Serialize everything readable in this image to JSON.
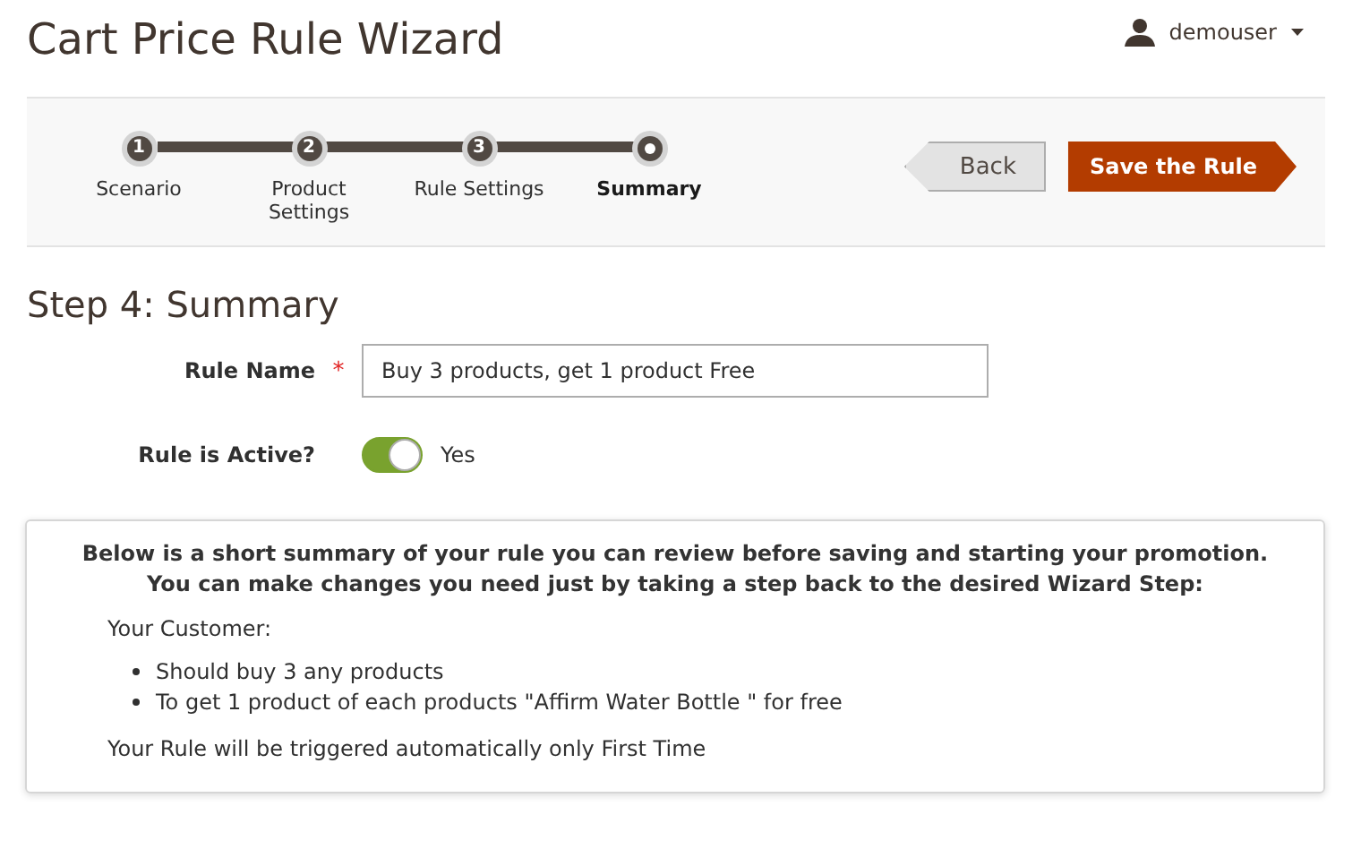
{
  "page_title": "Cart Price Rule Wizard",
  "user_menu": {
    "name": "demouser"
  },
  "steps": [
    {
      "number": "1",
      "label": "Scenario",
      "selected": false
    },
    {
      "number": "2",
      "label": "Product Settings",
      "selected": false
    },
    {
      "number": "3",
      "label": "Rule Settings",
      "selected": false
    },
    {
      "label": "Summary",
      "selected": true
    }
  ],
  "buttons": {
    "back": "Back",
    "save": "Save the Rule"
  },
  "section_title": "Step 4: Summary",
  "form": {
    "rule_name": {
      "label": "Rule Name",
      "required_mark": "*",
      "value": "Buy 3 products, get 1 product Free"
    },
    "rule_active": {
      "label": "Rule is Active?",
      "on": true,
      "state_text": "Yes"
    }
  },
  "summary": {
    "intro": [
      "Below is a short summary of your rule you can review before saving and starting your promotion.",
      "You can make changes you need just by taking a step back to the desired Wizard Step:"
    ],
    "customer_heading": "Your Customer:",
    "items": [
      "Should buy 3 any products",
      "To get 1 product of each products \"Affirm Water Bottle \" for free"
    ],
    "footer": "Your Rule will be triggered automatically only First Time"
  }
}
